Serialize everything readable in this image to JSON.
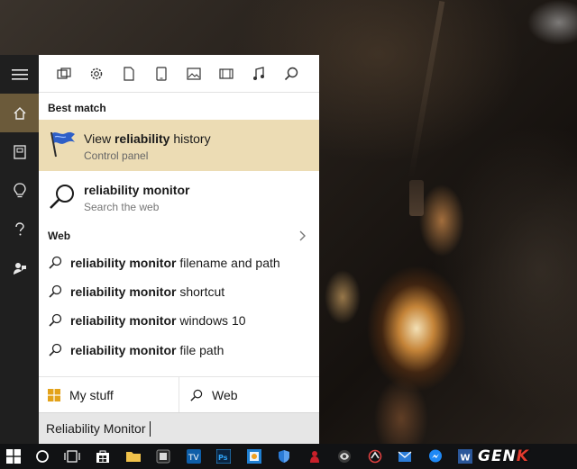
{
  "panel": {
    "filters": [
      "apps-icon",
      "settings-icon",
      "documents-icon",
      "tablet-icon",
      "photos-icon",
      "videos-icon",
      "music-icon",
      "search-icon"
    ],
    "best_match_header": "Best match",
    "best_match": {
      "title_pre": "View ",
      "title_bold": "reliability",
      "title_post": " history",
      "subtitle": "Control panel",
      "icon": "reliability-flag-icon"
    },
    "web_result": {
      "title": "reliability monitor",
      "subtitle": "Search the web",
      "icon": "magnifier-icon"
    },
    "web_header": "Web",
    "suggestions": [
      {
        "bold": "reliability monitor",
        "rest": " filename and path"
      },
      {
        "bold": "reliability monitor",
        "rest": " shortcut"
      },
      {
        "bold": "reliability monitor",
        "rest": " windows 10"
      },
      {
        "bold": "reliability monitor",
        "rest": " file path"
      }
    ],
    "scope": {
      "my_stuff": "My stuff",
      "web": "Web"
    },
    "search_value": "Reliability Monitor"
  },
  "rail": [
    "menu-icon",
    "home-icon",
    "notebook-icon",
    "lightbulb-icon",
    "help-icon",
    "feedback-icon"
  ],
  "taskbar": {
    "items": [
      "start-icon",
      "cortana-icon",
      "task-view-icon",
      "store-icon",
      "file-explorer-icon",
      "app-icon",
      "teamviewer-icon",
      "photoshop-icon",
      "app-icon",
      "security-icon",
      "app-icon",
      "app-icon",
      "app-icon",
      "mail-icon",
      "messenger-icon",
      "word-icon"
    ],
    "watermark_a": "GEN",
    "watermark_b": "K"
  },
  "colors": {
    "accent": "#ecdcb4",
    "rail_active": "#6b5a3a"
  }
}
